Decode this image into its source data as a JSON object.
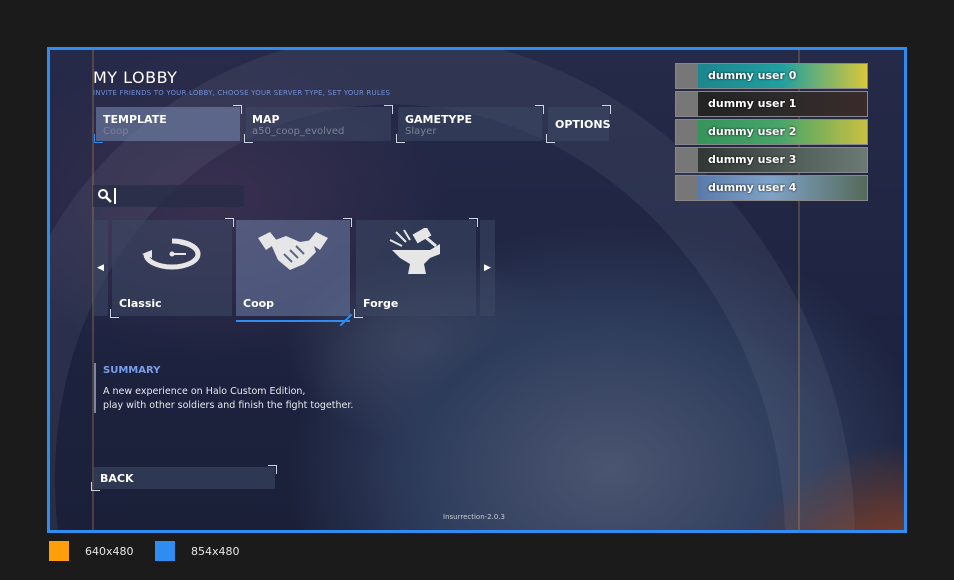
{
  "lobby": {
    "title": "MY LOBBY",
    "subtitle": "INVITE FRIENDS TO YOUR LOBBY, CHOOSE YOUR SERVER TYPE, SET YOUR RULES"
  },
  "tabs": [
    {
      "label": "TEMPLATE",
      "value": "Coop"
    },
    {
      "label": "MAP",
      "value": "a50_coop_evolved"
    },
    {
      "label": "GAMETYPE",
      "value": "Slayer"
    },
    {
      "label": "OPTIONS",
      "value": ""
    }
  ],
  "search": {
    "value": "",
    "placeholder": ""
  },
  "carousel": {
    "prev_glyph": "◀",
    "next_glyph": "▶",
    "items": [
      {
        "label": "Classic",
        "icon": "halo-ring-icon"
      },
      {
        "label": "Coop",
        "icon": "handshake-icon",
        "selected": true
      },
      {
        "label": "Forge",
        "icon": "anvil-hammer-icon"
      }
    ]
  },
  "summary": {
    "heading": "SUMMARY",
    "line1": "A new experience on Halo Custom Edition,",
    "line2": "play with other soldiers and finish the fight together."
  },
  "back": {
    "label": "BACK"
  },
  "version": "Insurrection-2.0.3",
  "players": [
    {
      "name": "dummy user 0"
    },
    {
      "name": "dummy user 1"
    },
    {
      "name": "dummy user 2"
    },
    {
      "name": "dummy user 3"
    },
    {
      "name": "dummy user 4"
    }
  ],
  "legend": [
    {
      "label": "640x480",
      "color": "#ff9f0a"
    },
    {
      "label": "854x480",
      "color": "#2f8cf0"
    }
  ],
  "colors": {
    "accent": "#2f8cf0",
    "subtitle": "#6f8fd8",
    "summary_heading": "#7a9ee8"
  }
}
